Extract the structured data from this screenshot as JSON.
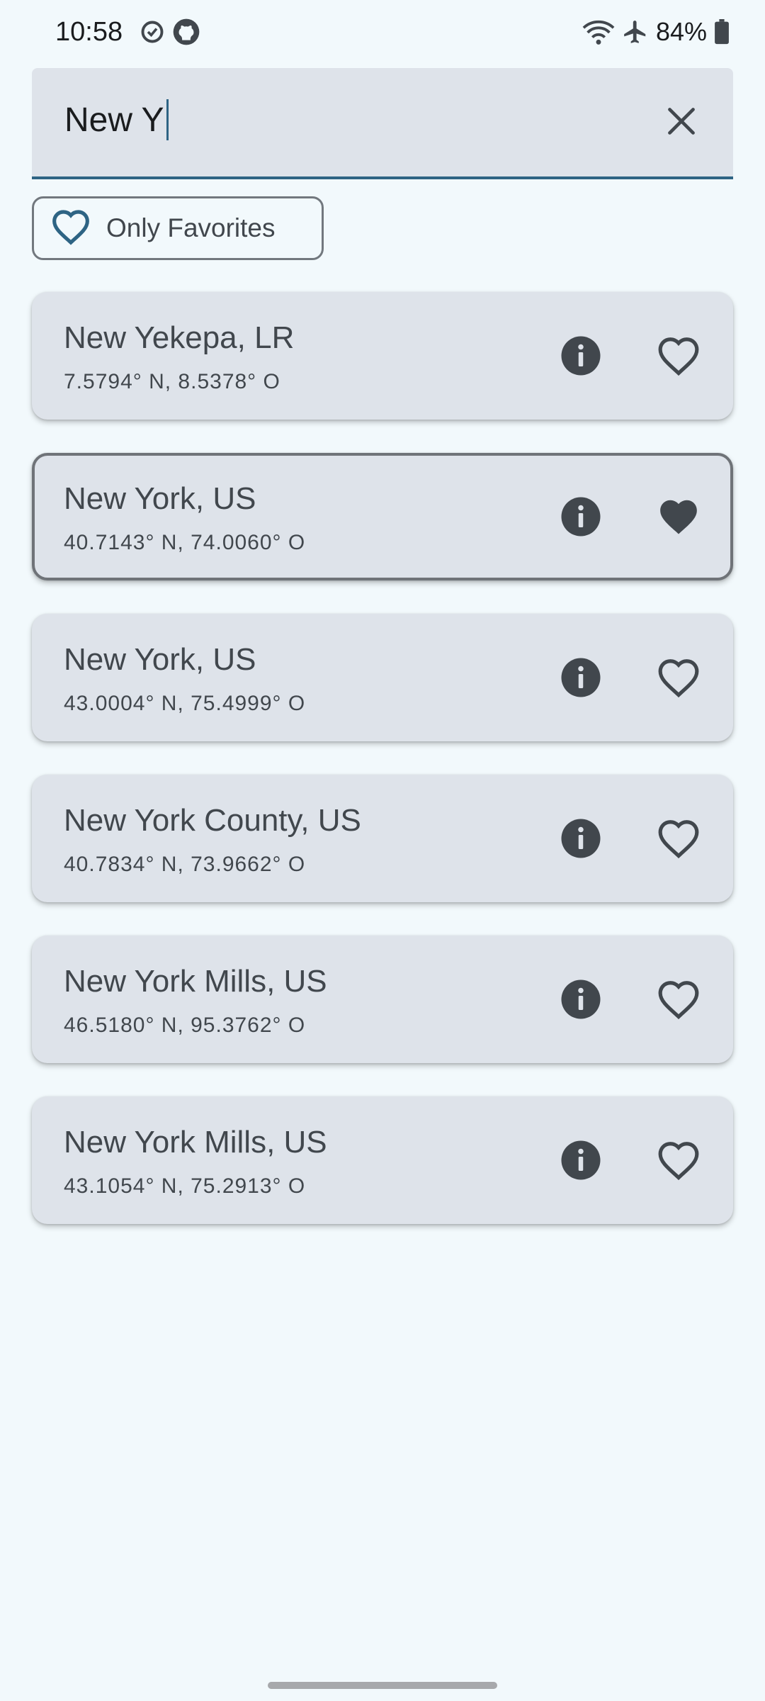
{
  "status_bar": {
    "time": "10:58",
    "battery": "84%",
    "icons": [
      "sync-icon",
      "github-icon",
      "wifi-icon",
      "airplane-mode-icon",
      "battery-icon"
    ]
  },
  "search": {
    "value": "New Y",
    "clear_icon": "close-icon"
  },
  "filter_chip": {
    "label": "Only Favorites",
    "icon": "heart-outline-icon"
  },
  "results": [
    {
      "name": "New Yekepa, LR",
      "coords": "7.5794° N, 8.5378° O",
      "favorite": false
    },
    {
      "name": "New York, US",
      "coords": "40.7143° N, 74.0060° O",
      "favorite": true
    },
    {
      "name": "New York, US",
      "coords": "43.0004° N, 75.4999° O",
      "favorite": false
    },
    {
      "name": "New York County, US",
      "coords": "40.7834° N, 73.9662° O",
      "favorite": false
    },
    {
      "name": "New York Mills, US",
      "coords": "46.5180° N, 95.3762° O",
      "favorite": false
    },
    {
      "name": "New York Mills, US",
      "coords": "43.1054° N, 75.2913° O",
      "favorite": false
    }
  ],
  "colors": {
    "background": "#F2F9FC",
    "surface": "#DEE3EA",
    "primary": "#2E6484",
    "on_surface": "#41474D"
  }
}
